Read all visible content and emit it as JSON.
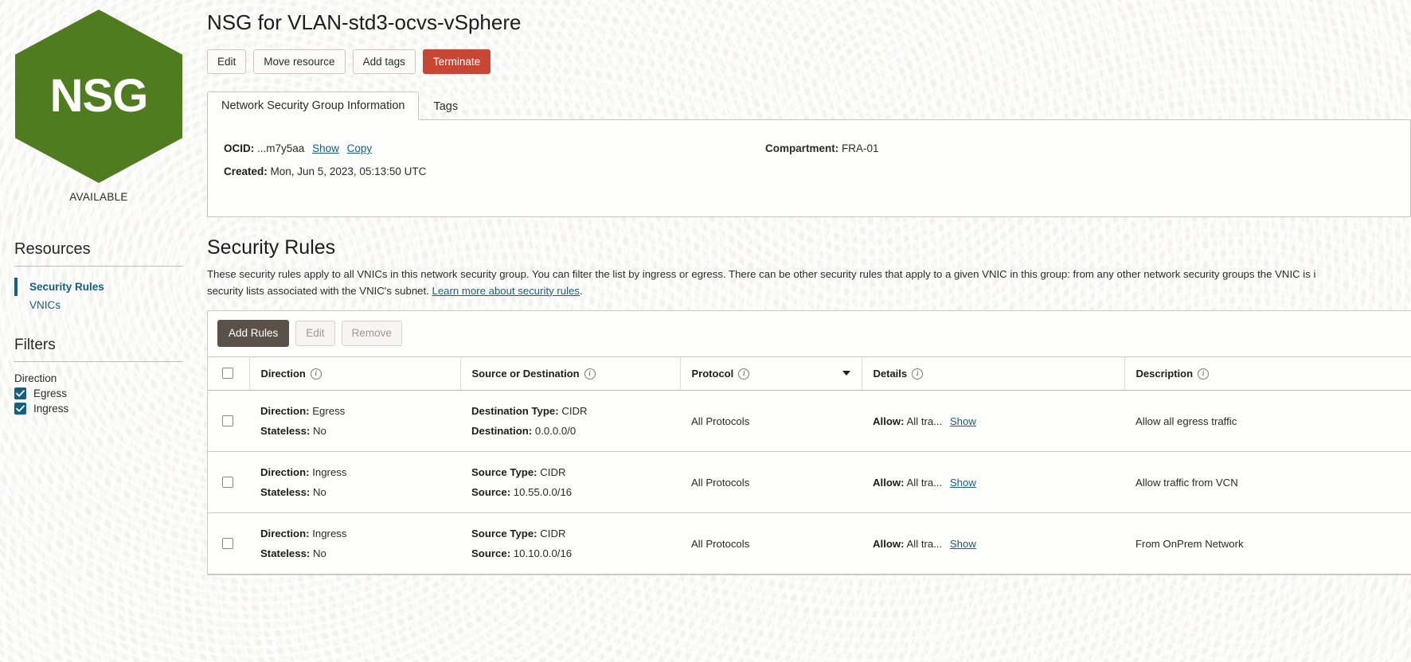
{
  "sidebar": {
    "logo_label": "NSG",
    "status": "AVAILABLE",
    "resources_heading": "Resources",
    "resource_links": [
      {
        "label": "Security Rules",
        "active": true
      },
      {
        "label": "VNICs",
        "active": false
      }
    ],
    "filters_heading": "Filters",
    "direction_filter": {
      "label": "Direction",
      "options": [
        {
          "label": "Egress",
          "checked": true
        },
        {
          "label": "Ingress",
          "checked": true
        }
      ]
    }
  },
  "header": {
    "title": "NSG for VLAN-std3-ocvs-vSphere",
    "actions": [
      {
        "label": "Edit",
        "style": "default"
      },
      {
        "label": "Move resource",
        "style": "default"
      },
      {
        "label": "Add tags",
        "style": "default"
      },
      {
        "label": "Terminate",
        "style": "danger"
      }
    ]
  },
  "tabs": [
    {
      "label": "Network Security Group Information",
      "active": true
    },
    {
      "label": "Tags",
      "active": false
    }
  ],
  "info_panel": {
    "ocid_label": "OCID:",
    "ocid_value": "...m7y5aa",
    "show_link": "Show",
    "copy_link": "Copy",
    "created_label": "Created:",
    "created_value": "Mon, Jun 5, 2023, 05:13:50 UTC",
    "compartment_label": "Compartment:",
    "compartment_value": "FRA-01"
  },
  "security_rules": {
    "title": "Security Rules",
    "description_part1": "These security rules apply to all VNICs in this network security group. You can filter the list by ingress or egress. There can be other security rules that apply to a given VNIC in this group: from any other network security groups the VNIC is i",
    "description_part2": "security lists associated with the VNIC's subnet. ",
    "description_link": "Learn more about security rules",
    "description_part3": ".",
    "toolbar": [
      {
        "label": "Add Rules",
        "style": "primary-dark",
        "disabled": false
      },
      {
        "label": "Edit",
        "style": "default",
        "disabled": true
      },
      {
        "label": "Remove",
        "style": "default",
        "disabled": true
      }
    ],
    "columns": [
      {
        "label": "Direction",
        "has_info": true
      },
      {
        "label": "Source or Destination",
        "has_info": true
      },
      {
        "label": "Protocol",
        "has_info": true,
        "has_caret": true
      },
      {
        "label": "Details",
        "has_info": true
      },
      {
        "label": "Description",
        "has_info": true
      }
    ],
    "rows": [
      {
        "direction_label": "Direction:",
        "direction_value": "Egress",
        "stateless_label": "Stateless:",
        "stateless_value": "No",
        "endpoint_type_label": "Destination Type:",
        "endpoint_type_value": "CIDR",
        "endpoint_label": "Destination:",
        "endpoint_value": "0.0.0.0/0",
        "protocol": "All Protocols",
        "details_label": "Allow:",
        "details_value": "All tra...",
        "details_link": "Show",
        "description": "Allow all egress traffic"
      },
      {
        "direction_label": "Direction:",
        "direction_value": "Ingress",
        "stateless_label": "Stateless:",
        "stateless_value": "No",
        "endpoint_type_label": "Source Type:",
        "endpoint_type_value": "CIDR",
        "endpoint_label": "Source:",
        "endpoint_value": "10.55.0.0/16",
        "protocol": "All Protocols",
        "details_label": "Allow:",
        "details_value": "All tra...",
        "details_link": "Show",
        "description": "Allow traffic from VCN"
      },
      {
        "direction_label": "Direction:",
        "direction_value": "Ingress",
        "stateless_label": "Stateless:",
        "stateless_value": "No",
        "endpoint_type_label": "Source Type:",
        "endpoint_type_value": "CIDR",
        "endpoint_label": "Source:",
        "endpoint_value": "10.10.0.0/16",
        "protocol": "All Protocols",
        "details_label": "Allow:",
        "details_value": "All tra...",
        "details_link": "Show",
        "description": "From OnPrem Network"
      }
    ]
  },
  "colors": {
    "logo_green": "#4e7c1e",
    "danger_red": "#c74634",
    "link_teal": "#16607d",
    "button_dark": "#5b514b",
    "page_bg": "#f2f1ef"
  }
}
